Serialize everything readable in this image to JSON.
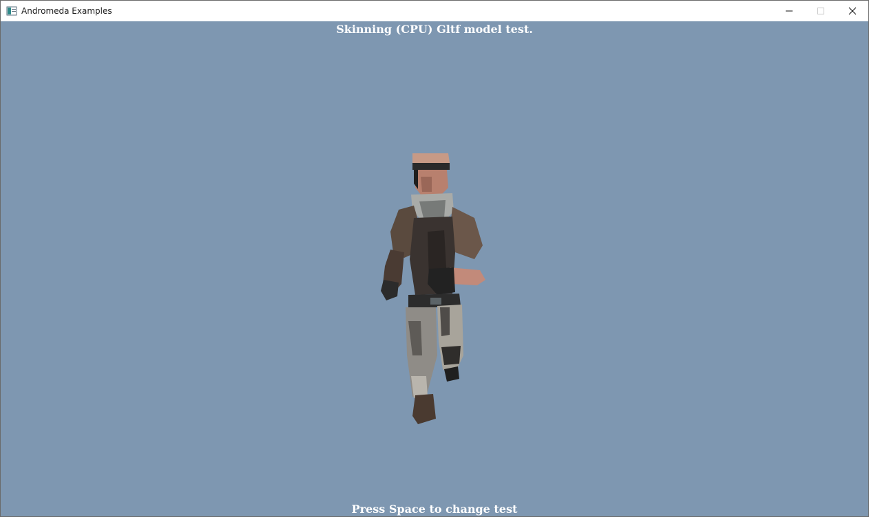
{
  "window": {
    "title": "Andromeda Examples",
    "icon": "app-window-icon",
    "controls": [
      "minimize-icon",
      "maximize-icon",
      "close-icon"
    ]
  },
  "scene": {
    "background_color": "#7e97b1",
    "top_text": "Skinning (CPU) Gltf model test.",
    "bottom_text": "Press Space to change test",
    "model_description_icon": "soldier-running-model"
  }
}
